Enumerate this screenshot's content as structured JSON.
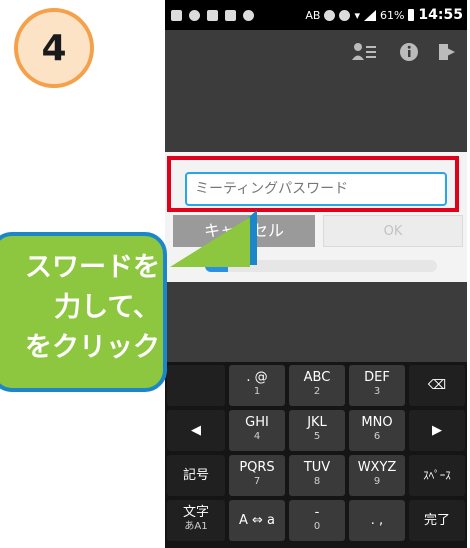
{
  "step": {
    "number": "4"
  },
  "status_bar": {
    "left_icons": [
      "message-icon",
      "clock-icon",
      "app-icon",
      "image-icon",
      "bell-icon"
    ],
    "ab": "AB",
    "battery": "61%",
    "time": "14:55"
  },
  "action_bar": {
    "icons": [
      "participants-icon",
      "info-icon",
      "exit-icon"
    ]
  },
  "dialog": {
    "password_placeholder": "ミーティングパスワード",
    "cancel_label": "キャンセル",
    "ok_label": "OK"
  },
  "progress": {
    "value": 0.1
  },
  "keyboard": {
    "rows": [
      [
        {
          "main": "",
          "sub": ""
        },
        {
          "main": ". @",
          "sub": "1"
        },
        {
          "main": "ABC",
          "sub": "2"
        },
        {
          "main": "DEF",
          "sub": "3"
        },
        {
          "main": "⌫",
          "sub": ""
        }
      ],
      [
        {
          "main": "◀",
          "sub": ""
        },
        {
          "main": "GHI",
          "sub": "4"
        },
        {
          "main": "JKL",
          "sub": "5"
        },
        {
          "main": "MNO",
          "sub": "6"
        },
        {
          "main": "▶",
          "sub": ""
        }
      ],
      [
        {
          "main": "記号",
          "sub": ""
        },
        {
          "main": "PQRS",
          "sub": "7"
        },
        {
          "main": "TUV",
          "sub": "8"
        },
        {
          "main": "WXYZ",
          "sub": "9"
        },
        {
          "main": "ｽﾍﾟｰｽ",
          "sub": ""
        }
      ],
      [
        {
          "main": "文字",
          "sub": "あA1"
        },
        {
          "main": "A ⇔ a",
          "sub": ""
        },
        {
          "main": "-",
          "sub": "0"
        },
        {
          "main": ". ,",
          "sub": ""
        },
        {
          "main": "完了",
          "sub": ""
        }
      ]
    ]
  },
  "callout": {
    "lines": [
      "スワードを",
      "力して、",
      "をクリック"
    ]
  },
  "colors": {
    "highlight": "#e0001b",
    "callout_fill": "#8dc63f",
    "callout_border": "#1b87c9",
    "input_border": "#29a6ea",
    "step_circle": "#fde3c6",
    "step_circle_border": "#f5a04a"
  }
}
